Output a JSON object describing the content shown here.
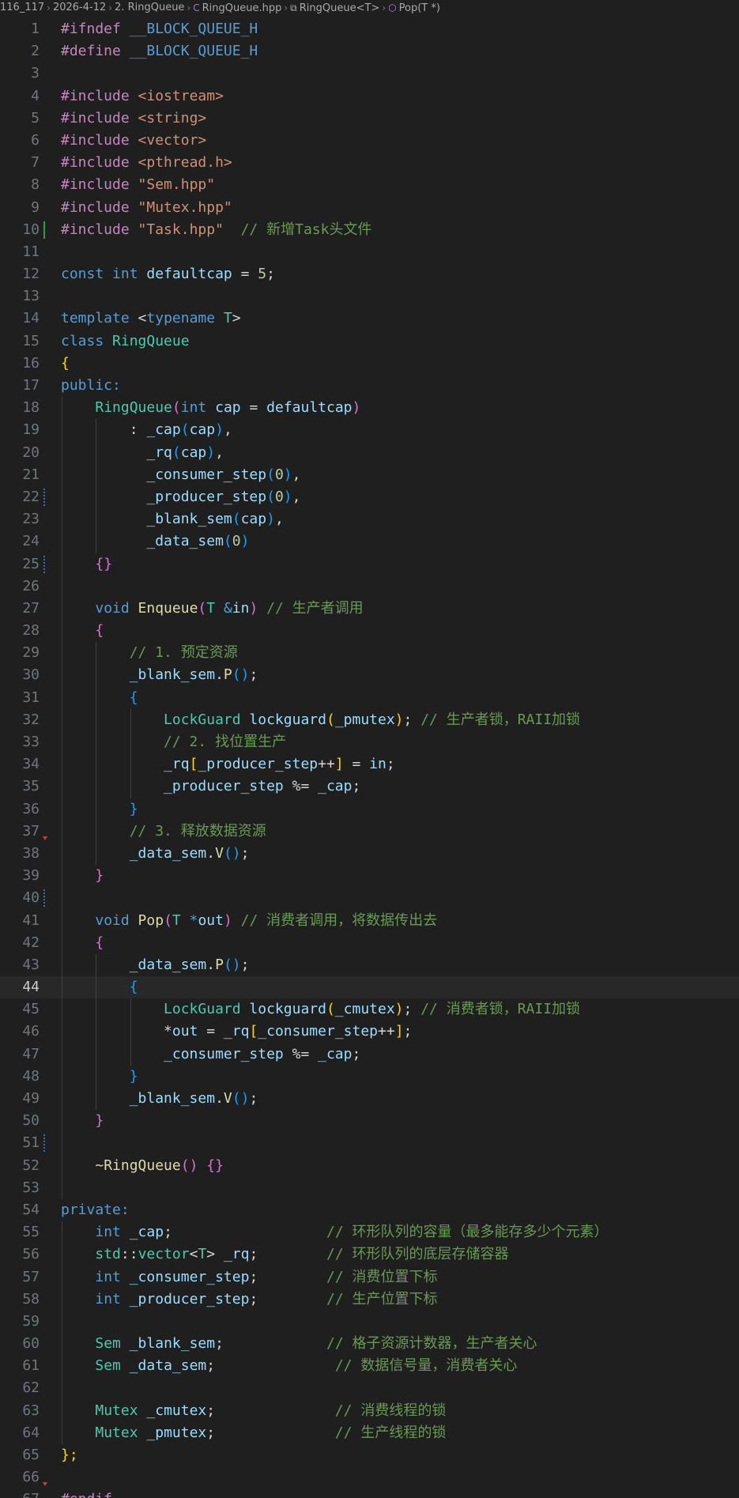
{
  "breadcrumb": {
    "items": [
      "116_117",
      "2026-4-12",
      "2. RingQueue",
      "RingQueue.hpp",
      "RingQueue<T>",
      "Pop(T *)"
    ],
    "icons": [
      "",
      "",
      "",
      "cpp-file-icon",
      "class-icon",
      "method-icon"
    ]
  },
  "editor": {
    "current_line": 44,
    "modified_lines": [
      10
    ],
    "hatched_lines": [
      22,
      25,
      40,
      51
    ],
    "arrow_lines": [
      37,
      66
    ]
  },
  "lines": [
    [
      [
        "#ifndef ",
        "pp"
      ],
      [
        "__BLOCK_QUEUE_H",
        "macro"
      ]
    ],
    [
      [
        "#define ",
        "pp"
      ],
      [
        "__BLOCK_QUEUE_H",
        "macro"
      ]
    ],
    [],
    [
      [
        "#include ",
        "pp"
      ],
      [
        "<iostream>",
        "str"
      ]
    ],
    [
      [
        "#include ",
        "pp"
      ],
      [
        "<string>",
        "str"
      ]
    ],
    [
      [
        "#include ",
        "pp"
      ],
      [
        "<vector>",
        "str"
      ]
    ],
    [
      [
        "#include ",
        "pp"
      ],
      [
        "<pthread.h>",
        "str"
      ]
    ],
    [
      [
        "#include ",
        "pp"
      ],
      [
        "\"Sem.hpp\"",
        "str"
      ]
    ],
    [
      [
        "#include ",
        "pp"
      ],
      [
        "\"Mutex.hpp\"",
        "str"
      ]
    ],
    [
      [
        "#include ",
        "pp"
      ],
      [
        "\"Task.hpp\"",
        "str"
      ],
      [
        "  // 新增Task头文件",
        "com"
      ]
    ],
    [],
    [
      [
        "const ",
        "kw"
      ],
      [
        "int ",
        "kw"
      ],
      [
        "defaultcap",
        "var"
      ],
      [
        " = ",
        "plain"
      ],
      [
        "5",
        "num"
      ],
      [
        ";",
        "plain"
      ]
    ],
    [],
    [
      [
        "template ",
        "kw"
      ],
      [
        "<",
        "plain"
      ],
      [
        "typename ",
        "kw"
      ],
      [
        "T",
        "type"
      ],
      [
        ">",
        "plain"
      ]
    ],
    [
      [
        "class ",
        "kw"
      ],
      [
        "RingQueue",
        "type"
      ]
    ],
    [
      [
        "{",
        "p1"
      ]
    ],
    [
      [
        "public:",
        "kw"
      ]
    ],
    [
      [
        "    ",
        "plain"
      ],
      [
        "RingQueue",
        "type"
      ],
      [
        "(",
        "p2"
      ],
      [
        "int ",
        "kw"
      ],
      [
        "cap",
        "param"
      ],
      [
        " = ",
        "plain"
      ],
      [
        "defaultcap",
        "var"
      ],
      [
        ")",
        "p2"
      ]
    ],
    [
      [
        "        : ",
        "plain"
      ],
      [
        "_cap",
        "member"
      ],
      [
        "(",
        "p3"
      ],
      [
        "cap",
        "param"
      ],
      [
        ")",
        "p3"
      ],
      [
        ",",
        "plain"
      ]
    ],
    [
      [
        "          ",
        "plain"
      ],
      [
        "_rq",
        "member"
      ],
      [
        "(",
        "p3"
      ],
      [
        "cap",
        "param"
      ],
      [
        ")",
        "p3"
      ],
      [
        ",",
        "plain"
      ]
    ],
    [
      [
        "          ",
        "plain"
      ],
      [
        "_consumer_step",
        "member"
      ],
      [
        "(",
        "p3"
      ],
      [
        "0",
        "num"
      ],
      [
        ")",
        "p3"
      ],
      [
        ",",
        "plain"
      ]
    ],
    [
      [
        "          ",
        "plain"
      ],
      [
        "_producer_step",
        "member"
      ],
      [
        "(",
        "p3"
      ],
      [
        "0",
        "num"
      ],
      [
        ")",
        "p3"
      ],
      [
        ",",
        "plain"
      ]
    ],
    [
      [
        "          ",
        "plain"
      ],
      [
        "_blank_sem",
        "member"
      ],
      [
        "(",
        "p3"
      ],
      [
        "cap",
        "param"
      ],
      [
        ")",
        "p3"
      ],
      [
        ",",
        "plain"
      ]
    ],
    [
      [
        "          ",
        "plain"
      ],
      [
        "_data_sem",
        "member"
      ],
      [
        "(",
        "p3"
      ],
      [
        "0",
        "num"
      ],
      [
        ")",
        "p3"
      ]
    ],
    [
      [
        "    ",
        "plain"
      ],
      [
        "{}",
        "p2"
      ]
    ],
    [],
    [
      [
        "    ",
        "plain"
      ],
      [
        "void ",
        "kw"
      ],
      [
        "Enqueue",
        "fn"
      ],
      [
        "(",
        "p2"
      ],
      [
        "T ",
        "type"
      ],
      [
        "&",
        "kw"
      ],
      [
        "in",
        "param"
      ],
      [
        ")",
        "p2"
      ],
      [
        " // 生产者调用",
        "com"
      ]
    ],
    [
      [
        "    ",
        "plain"
      ],
      [
        "{",
        "p2"
      ]
    ],
    [
      [
        "        ",
        "plain"
      ],
      [
        "// 1. 预定资源",
        "com"
      ]
    ],
    [
      [
        "        ",
        "plain"
      ],
      [
        "_blank_sem",
        "member"
      ],
      [
        ".",
        "plain"
      ],
      [
        "P",
        "fn"
      ],
      [
        "()",
        "p3"
      ],
      [
        ";",
        "plain"
      ]
    ],
    [
      [
        "        ",
        "plain"
      ],
      [
        "{",
        "p3"
      ]
    ],
    [
      [
        "            ",
        "plain"
      ],
      [
        "LockGuard ",
        "type"
      ],
      [
        "lockguard",
        "var"
      ],
      [
        "(",
        "p1"
      ],
      [
        "_pmutex",
        "member"
      ],
      [
        ")",
        "p1"
      ],
      [
        ";",
        "plain"
      ],
      [
        " // 生产者锁，RAII加锁",
        "com"
      ]
    ],
    [
      [
        "            ",
        "plain"
      ],
      [
        "// 2. 找位置生产",
        "com"
      ]
    ],
    [
      [
        "            ",
        "plain"
      ],
      [
        "_rq",
        "member"
      ],
      [
        "[",
        "p1"
      ],
      [
        "_producer_step",
        "member"
      ],
      [
        "++",
        "plain"
      ],
      [
        "]",
        "p1"
      ],
      [
        " = ",
        "plain"
      ],
      [
        "in",
        "param"
      ],
      [
        ";",
        "plain"
      ]
    ],
    [
      [
        "            ",
        "plain"
      ],
      [
        "_producer_step",
        "member"
      ],
      [
        " %= ",
        "plain"
      ],
      [
        "_cap",
        "member"
      ],
      [
        ";",
        "plain"
      ]
    ],
    [
      [
        "        ",
        "plain"
      ],
      [
        "}",
        "p3"
      ]
    ],
    [
      [
        "        ",
        "plain"
      ],
      [
        "// 3. 释放数据资源",
        "com"
      ]
    ],
    [
      [
        "        ",
        "plain"
      ],
      [
        "_data_sem",
        "member"
      ],
      [
        ".",
        "plain"
      ],
      [
        "V",
        "fn"
      ],
      [
        "()",
        "p3"
      ],
      [
        ";",
        "plain"
      ]
    ],
    [
      [
        "    ",
        "plain"
      ],
      [
        "}",
        "p2"
      ]
    ],
    [],
    [
      [
        "    ",
        "plain"
      ],
      [
        "void ",
        "kw"
      ],
      [
        "Pop",
        "fn"
      ],
      [
        "(",
        "p2"
      ],
      [
        "T ",
        "type"
      ],
      [
        "*",
        "kw"
      ],
      [
        "out",
        "param"
      ],
      [
        ")",
        "p2"
      ],
      [
        " // 消费者调用，将数据传出去",
        "com"
      ]
    ],
    [
      [
        "    ",
        "plain"
      ],
      [
        "{",
        "p2"
      ]
    ],
    [
      [
        "        ",
        "plain"
      ],
      [
        "_data_sem",
        "member"
      ],
      [
        ".",
        "plain"
      ],
      [
        "P",
        "fn"
      ],
      [
        "()",
        "p3"
      ],
      [
        ";",
        "plain"
      ]
    ],
    [
      [
        "        ",
        "plain"
      ],
      [
        "{",
        "p3"
      ]
    ],
    [
      [
        "            ",
        "plain"
      ],
      [
        "LockGuard ",
        "type"
      ],
      [
        "lockguard",
        "var"
      ],
      [
        "(",
        "p1"
      ],
      [
        "_cmutex",
        "member"
      ],
      [
        ")",
        "p1"
      ],
      [
        ";",
        "plain"
      ],
      [
        " // 消费者锁，RAII加锁",
        "com"
      ]
    ],
    [
      [
        "            ",
        "plain"
      ],
      [
        "*",
        "plain"
      ],
      [
        "out",
        "param"
      ],
      [
        " = ",
        "plain"
      ],
      [
        "_rq",
        "member"
      ],
      [
        "[",
        "p1"
      ],
      [
        "_consumer_step",
        "member"
      ],
      [
        "++",
        "plain"
      ],
      [
        "]",
        "p1"
      ],
      [
        ";",
        "plain"
      ]
    ],
    [
      [
        "            ",
        "plain"
      ],
      [
        "_consumer_step",
        "member"
      ],
      [
        " %= ",
        "plain"
      ],
      [
        "_cap",
        "member"
      ],
      [
        ";",
        "plain"
      ]
    ],
    [
      [
        "        ",
        "plain"
      ],
      [
        "}",
        "p3"
      ]
    ],
    [
      [
        "        ",
        "plain"
      ],
      [
        "_blank_sem",
        "member"
      ],
      [
        ".",
        "plain"
      ],
      [
        "V",
        "fn"
      ],
      [
        "()",
        "p3"
      ],
      [
        ";",
        "plain"
      ]
    ],
    [
      [
        "    ",
        "plain"
      ],
      [
        "}",
        "p2"
      ]
    ],
    [],
    [
      [
        "    ",
        "plain"
      ],
      [
        "~RingQueue",
        "fn"
      ],
      [
        "() ",
        "p2"
      ],
      [
        "{}",
        "p2"
      ]
    ],
    [],
    [
      [
        "private:",
        "kw"
      ]
    ],
    [
      [
        "    ",
        "plain"
      ],
      [
        "int ",
        "kw"
      ],
      [
        "_cap",
        "member"
      ],
      [
        ";",
        "plain"
      ],
      [
        "                  // 环形队列的容量（最多能存多少个元素）",
        "com"
      ]
    ],
    [
      [
        "    ",
        "plain"
      ],
      [
        "std",
        "type"
      ],
      [
        "::",
        "plain"
      ],
      [
        "vector",
        "type"
      ],
      [
        "<",
        "plain"
      ],
      [
        "T",
        "type"
      ],
      [
        "> ",
        "plain"
      ],
      [
        "_rq",
        "member"
      ],
      [
        ";",
        "plain"
      ],
      [
        "        // 环形队列的底层存储容器",
        "com"
      ]
    ],
    [
      [
        "    ",
        "plain"
      ],
      [
        "int ",
        "kw"
      ],
      [
        "_consumer_step",
        "member"
      ],
      [
        ";",
        "plain"
      ],
      [
        "        // 消费位置下标",
        "com"
      ]
    ],
    [
      [
        "    ",
        "plain"
      ],
      [
        "int ",
        "kw"
      ],
      [
        "_producer_step",
        "member"
      ],
      [
        ";",
        "plain"
      ],
      [
        "        // 生产位置下标",
        "com"
      ]
    ],
    [],
    [
      [
        "    ",
        "plain"
      ],
      [
        "Sem ",
        "type"
      ],
      [
        "_blank_sem",
        "member"
      ],
      [
        ";",
        "plain"
      ],
      [
        "            // 格子资源计数器，生产者关心",
        "com"
      ]
    ],
    [
      [
        "    ",
        "plain"
      ],
      [
        "Sem ",
        "type"
      ],
      [
        "_data_sem",
        "member"
      ],
      [
        ";",
        "plain"
      ],
      [
        "              // 数据信号量，消费者关心",
        "com"
      ]
    ],
    [],
    [
      [
        "    ",
        "plain"
      ],
      [
        "Mutex ",
        "type"
      ],
      [
        "_cmutex",
        "member"
      ],
      [
        ";",
        "plain"
      ],
      [
        "              // 消费线程的锁",
        "com"
      ]
    ],
    [
      [
        "    ",
        "plain"
      ],
      [
        "Mutex ",
        "type"
      ],
      [
        "_pmutex",
        "member"
      ],
      [
        ";",
        "plain"
      ],
      [
        "              // 生产线程的锁",
        "com"
      ]
    ],
    [
      [
        "};",
        "p1"
      ]
    ],
    [],
    [
      [
        "#endif",
        "pp"
      ]
    ]
  ],
  "guides": {
    "18": [
      1
    ],
    "19": [
      1,
      2
    ],
    "20": [
      1,
      2
    ],
    "21": [
      1,
      2
    ],
    "22": [
      1,
      2
    ],
    "23": [
      1,
      2
    ],
    "24": [
      1,
      2
    ],
    "25": [
      1
    ],
    "26": [
      1
    ],
    "27": [
      1
    ],
    "28": [
      1
    ],
    "29": [
      1,
      2
    ],
    "30": [
      1,
      2
    ],
    "31": [
      1,
      2
    ],
    "32": [
      1,
      2,
      3
    ],
    "33": [
      1,
      2,
      3
    ],
    "34": [
      1,
      2,
      3
    ],
    "35": [
      1,
      2,
      3
    ],
    "36": [
      1,
      2
    ],
    "37": [
      1,
      2
    ],
    "38": [
      1,
      2
    ],
    "39": [
      1
    ],
    "40": [
      1
    ],
    "41": [
      1
    ],
    "42": [
      1
    ],
    "43": [
      1,
      2
    ],
    "44": [
      1,
      2
    ],
    "45": [
      1,
      2,
      3
    ],
    "46": [
      1,
      2,
      3
    ],
    "47": [
      1,
      2,
      3
    ],
    "48": [
      1,
      2
    ],
    "49": [
      1,
      2
    ],
    "50": [
      1
    ],
    "51": [
      1
    ],
    "52": [
      1
    ],
    "53": [
      1
    ],
    "55": [
      1
    ],
    "56": [
      1
    ],
    "57": [
      1
    ],
    "58": [
      1
    ],
    "59": [
      1
    ],
    "60": [
      1
    ],
    "61": [
      1
    ],
    "62": [
      1
    ],
    "63": [
      1
    ],
    "64": [
      1
    ]
  }
}
